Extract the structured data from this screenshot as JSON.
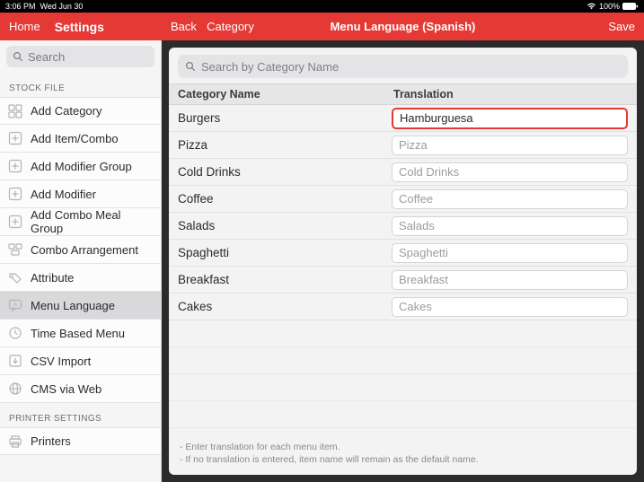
{
  "statusbar": {
    "time": "3:06 PM",
    "date": "Wed Jun 30",
    "battery": "100%"
  },
  "header": {
    "home": "Home",
    "settings": "Settings",
    "back": "Back",
    "category": "Category",
    "title": "Menu Language (Spanish)",
    "save": "Save"
  },
  "sidebar": {
    "search_placeholder": "Search",
    "section_stock": "STOCK FILE",
    "section_printer": "PRINTER SETTINGS",
    "items": [
      {
        "label": "Add Category",
        "icon": "grid"
      },
      {
        "label": "Add Item/Combo",
        "icon": "plus"
      },
      {
        "label": "Add Modifier Group",
        "icon": "plus"
      },
      {
        "label": "Add Modifier",
        "icon": "plus"
      },
      {
        "label": "Add Combo Meal Group",
        "icon": "plus"
      },
      {
        "label": "Combo Arrangement",
        "icon": "combo"
      },
      {
        "label": "Attribute",
        "icon": "tag"
      },
      {
        "label": "Menu Language",
        "icon": "chat"
      },
      {
        "label": "Time Based Menu",
        "icon": "clock"
      },
      {
        "label": "CSV Import",
        "icon": "import"
      },
      {
        "label": "CMS via Web",
        "icon": "web"
      }
    ],
    "printer_items": [
      {
        "label": "Printers",
        "icon": "printer"
      }
    ]
  },
  "main": {
    "search_placeholder": "Search by Category Name",
    "col_category": "Category Name",
    "col_translation": "Translation",
    "rows": [
      {
        "name": "Burgers",
        "value": "Hamburguesa",
        "highlight": true
      },
      {
        "name": "Pizza",
        "placeholder": "Pizza"
      },
      {
        "name": "Cold Drinks",
        "placeholder": "Cold Drinks"
      },
      {
        "name": "Coffee",
        "placeholder": "Coffee"
      },
      {
        "name": "Salads",
        "placeholder": "Salads"
      },
      {
        "name": "Spaghetti",
        "placeholder": "Spaghetti"
      },
      {
        "name": "Breakfast",
        "placeholder": "Breakfast"
      },
      {
        "name": "Cakes",
        "placeholder": "Cakes"
      }
    ],
    "footnote_1": "- Enter translation for each menu item.",
    "footnote_2": "- If no translation is entered, item name will remain as the default name."
  }
}
